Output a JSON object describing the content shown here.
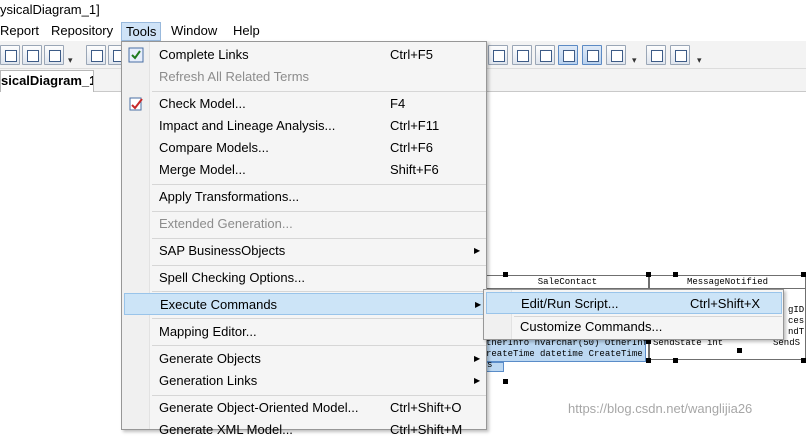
{
  "window": {
    "title": "ysicalDiagram_1]"
  },
  "menubar": {
    "items": [
      {
        "label": "Report"
      },
      {
        "label": "Repository"
      },
      {
        "label": "Tools"
      },
      {
        "label": "Window"
      },
      {
        "label": "Help"
      }
    ]
  },
  "tabs": {
    "active": "sicalDiagram_1"
  },
  "tools_menu": {
    "items": [
      {
        "label": "Complete Links",
        "shortcut": "Ctrl+F5",
        "icon": "complete-links-icon"
      },
      {
        "label": "Refresh All Related Terms",
        "shortcut": ""
      },
      {
        "label": "Check Model...",
        "shortcut": "F4",
        "icon": "check-model-icon"
      },
      {
        "label": "Impact and Lineage Analysis...",
        "shortcut": "Ctrl+F11"
      },
      {
        "label": "Compare Models...",
        "shortcut": "Ctrl+F6"
      },
      {
        "label": "Merge Model...",
        "shortcut": "Shift+F6"
      },
      {
        "label": "Apply Transformations...",
        "shortcut": ""
      },
      {
        "label": "Extended Generation...",
        "shortcut": ""
      },
      {
        "label": "SAP BusinessObjects",
        "shortcut": ""
      },
      {
        "label": "Spell Checking Options...",
        "shortcut": ""
      },
      {
        "label": "Execute Commands",
        "shortcut": ""
      },
      {
        "label": "Mapping Editor...",
        "shortcut": ""
      },
      {
        "label": "Generate Objects",
        "shortcut": ""
      },
      {
        "label": "Generation Links",
        "shortcut": ""
      },
      {
        "label": "Generate Object-Oriented Model...",
        "shortcut": "Ctrl+Shift+O"
      },
      {
        "label": "Generate XML Model...",
        "shortcut": "Ctrl+Shift+M"
      }
    ]
  },
  "execute_submenu": {
    "items": [
      {
        "label": "Edit/Run Script...",
        "shortcut": "Ctrl+Shift+X"
      },
      {
        "label": "Customize Commands...",
        "shortcut": ""
      }
    ]
  },
  "diagram": {
    "tables": [
      {
        "name": "SaleContact"
      },
      {
        "name": "MessageNotified"
      }
    ],
    "rows": [
      {
        "text": "gID"
      },
      {
        "text": "ces"
      },
      {
        "text": "ndT"
      },
      {
        "text": "therInfo    nvarchar(50)  OtherInf"
      },
      {
        "text": "reateTime   datetime      CreateTime"
      },
      {
        "text": "SendState  int"
      },
      {
        "text": "SendS"
      },
      {
        "text": "s"
      }
    ]
  },
  "watermark": {
    "text": "https://blog.csdn.net/wanglijia26"
  },
  "colors": {
    "menu_highlight": "#cce4f7",
    "menu_highlight_border": "#99c4ea",
    "selection_fill": "#bcd8f2"
  }
}
